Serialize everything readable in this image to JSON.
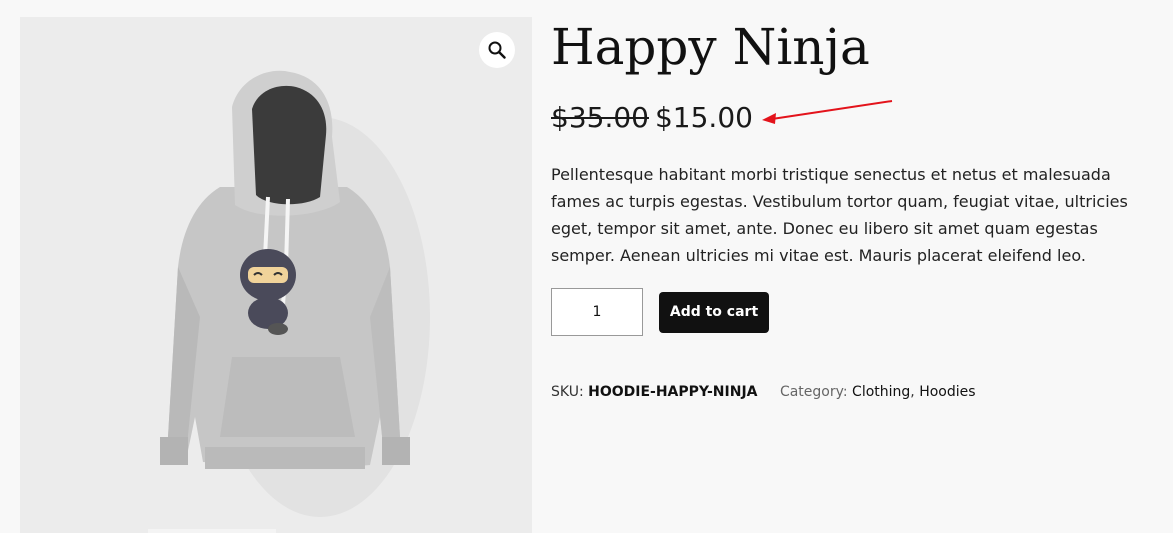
{
  "product": {
    "title": "Happy Ninja",
    "price_regular": "$35.00",
    "price_sale": "$15.00",
    "description": "Pellentesque habitant morbi tristique senectus et netus et malesuada fames ac turpis egestas. Vestibulum tortor quam, feugiat vitae, ultricies eget, tempor sit amet, ante. Donec eu libero sit amet quam egestas semper. Aenean ultricies mi vitae est. Mauris placerat eleifend leo.",
    "quantity": "1",
    "add_to_cart_label": "Add to cart",
    "sku_label": "SKU:",
    "sku_value": "HOODIE-HAPPY-NINJA",
    "category_label": "Category:",
    "categories": [
      "Clothing",
      "Hoodies"
    ],
    "category_separator": ","
  },
  "icons": {
    "zoom": "magnifier-icon",
    "annotation": "red-arrow"
  },
  "colors": {
    "button_bg": "#111111",
    "arrow": "#e3131b",
    "hoodie": "#c9c9c9"
  }
}
